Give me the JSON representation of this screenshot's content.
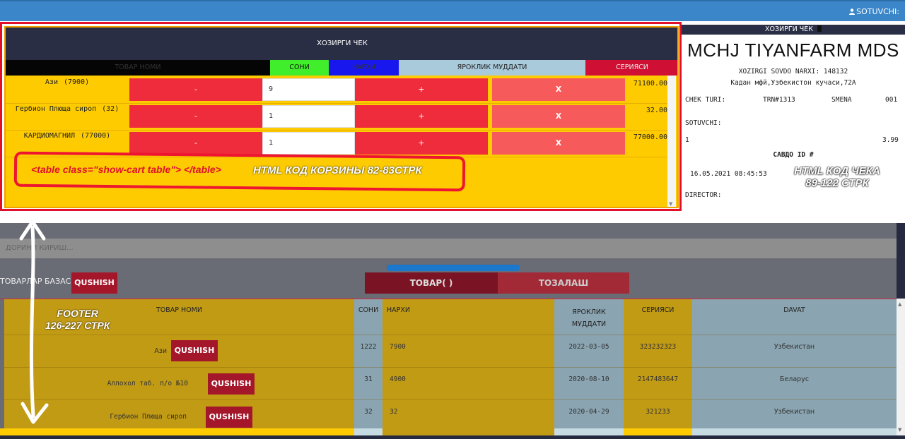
{
  "topbar": {
    "user_label": "SOTUVCHI:",
    "user_icon": "user-icon",
    "color": "#3b86c9"
  },
  "cart": {
    "title": "ХОЗИРГИ ЧЕК",
    "columns": {
      "name": "ТОВАР НОМИ",
      "qty": "СОНИ",
      "price": "НАРХИ",
      "expiry": "ЯРОКЛИК МУДДАТИ",
      "series": "СЕРИЯСИ"
    },
    "rows": [
      {
        "name": "Ази",
        "unit_price": "(7900)",
        "minus": "-",
        "qty": "9",
        "plus": "+",
        "remove": "X",
        "total": "71100.00"
      },
      {
        "name": "Гербион Плюща сироп",
        "unit_price": "(32)",
        "minus": "-",
        "qty": "1",
        "plus": "+",
        "remove": "X",
        "total": "32.00"
      },
      {
        "name": "КАРДИОМАГНИЛ",
        "unit_price": "(77000)",
        "minus": "-",
        "qty": "1",
        "plus": "+",
        "remove": "X",
        "total": "77000.00"
      }
    ],
    "annotation_code": "<table class=\"show-cart table\">   </table>",
    "annotation_text": "HTML КОД КОРЗИНЫ      82-83СТРК"
  },
  "receipt": {
    "header": "ХОЗИРГИ ЧЕК",
    "company": "MCHJ TIYANFARM MDS",
    "sovdo_narxi": "XOZIRGI SOVDO NARXI: 148132",
    "address": "Кадан мфй,Узбекистон кучаси,72А",
    "chek_turi_label": "CHEK TURI:",
    "trn": "TRN#1313",
    "smena_label": "SMENA",
    "smena_value": "001",
    "sotuvchi_label": "SOTUVCHI:",
    "line_left": "1",
    "line_right": "3.99",
    "savdo_id": "САВДО ID #",
    "datetime": "16.05.2021 08:45:53",
    "director": "DIRECTOR:",
    "annotation_line1": "HTML КОД ЧЕКА",
    "annotation_line2": "89-122 СТРК"
  },
  "lower": {
    "search_placeholder": "ДОРИНИ КИРИШ...",
    "db_label": "ТОВАРЛАР БАЗАСИ",
    "add_button": "QUSHISH",
    "category_button": "ТОВАР( )",
    "clear_button": "ТОЗАЛАШ",
    "footer_annotation_line1": "FOOTER",
    "footer_annotation_line2": "126-227 СТРК"
  },
  "products": {
    "columns": {
      "name": "ТОВАР НОМИ",
      "qty": "СОНИ",
      "price": "НАРХИ",
      "expiry_l1": "ЯРОКЛИК",
      "expiry_l2": "МУДДАТИ",
      "series": "СЕРИЯСИ",
      "country": "DAVAT"
    },
    "rows": [
      {
        "name": "Ази",
        "button": "QUSHISH",
        "qty": "1222",
        "price": "7900",
        "expiry": "2022-03-05",
        "series": "323232323",
        "country": "Узбекистан"
      },
      {
        "name": "Аллохол таб. п/о №10",
        "button": "QUSHISH",
        "qty": "31",
        "price": "4900",
        "expiry": "2020-08-10",
        "series": "2147483647",
        "country": "Беларус"
      },
      {
        "name": "Гербион Плюща сироп",
        "button": "QUSHISH",
        "qty": "32",
        "price": "32",
        "expiry": "2020-04-29",
        "series": "321233",
        "country": "Узбекистан"
      }
    ]
  },
  "colors": {
    "cart_bg": "#fecb00",
    "accent_red": "#ee2c3c",
    "header_dark": "#2a2e45",
    "qty_header": "#40ee2c",
    "price_header": "#1818ee"
  }
}
